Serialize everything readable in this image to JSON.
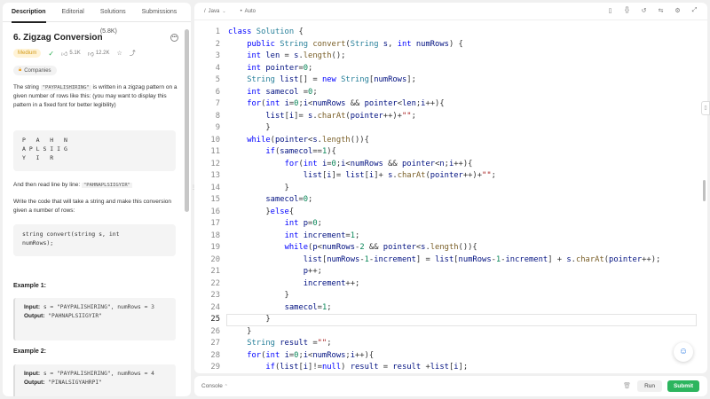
{
  "tabs": [
    "Description",
    "Editorial",
    "Solutions (5.8K)",
    "Submissions"
  ],
  "problem": {
    "title": "6. Zigzag Conversion",
    "difficulty": "Medium",
    "likes": "5.1K",
    "dislikes": "12.2K",
    "companies": "Companies",
    "p1a": "The string ",
    "p1code": "\"PAYPALISHIRING\"",
    "p1b": " is written in a zigzag pattern on a given number of rows like this: (you may want to display this pattern in a fixed font for better legibility)",
    "pattern": "P   A   H   N\nA P L S I I G\nY   I   R",
    "p2a": "And then read line by line: ",
    "p2code": "\"PAHNAPLSIIGYIR\"",
    "p3": "Write the code that will take a string and make this conversion given a number of rows:",
    "signature": "string convert(string s, int\nnumRows);",
    "ex1_title": "Example 1:",
    "ex1_in_label": "Input:",
    "ex1_in": "s = \"PAYPALISHIRING\", numRows = 3",
    "ex1_out_label": "Output:",
    "ex1_out": "\"PAHNAPLSIIGYIR\"",
    "ex2_title": "Example 2:",
    "ex2_in_label": "Input:",
    "ex2_in": "s = \"PAYPALISHIRING\", numRows = 4",
    "ex2_out_label": "Output:",
    "ex2_out": "\"PINALSIGYAHRPI\""
  },
  "editor": {
    "language": "Java",
    "mode": "Auto",
    "active_line": 25,
    "lines": [
      "class Solution {",
      "    public String convert(String s, int numRows) {",
      "    int len = s.length();",
      "    int pointer=0;",
      "    String list[] = new String[numRows];",
      "    int samecol =0;",
      "    for(int i=0;i<numRows && pointer<len;i++){",
      "        list[i]= s.charAt(pointer++)+\"\";",
      "        }",
      "    while(pointer<s.length()){",
      "        if(samecol==1){",
      "            for(int i=0;i<numRows && pointer<n;i++){",
      "                list[i]= list[i]+ s.charAt(pointer++)+\"\";",
      "            }",
      "        samecol=0;",
      "        }else{",
      "            int p=0;",
      "            int increment=1;",
      "            while(p<numRows-2 && pointer<s.length()){",
      "                list[numRows-1-increment] = list[numRows-1-increment] + s.charAt(pointer++);",
      "                p++;",
      "                increment++;",
      "            }",
      "            samecol=1;",
      "        }",
      "    }",
      "    String result =\"\";",
      "    for(int i=0;i<numRows;i++){",
      "        if(list[i]!=null) result = result +list[i];"
    ]
  },
  "bottom": {
    "console": "Console",
    "run": "Run",
    "submit": "Submit"
  }
}
